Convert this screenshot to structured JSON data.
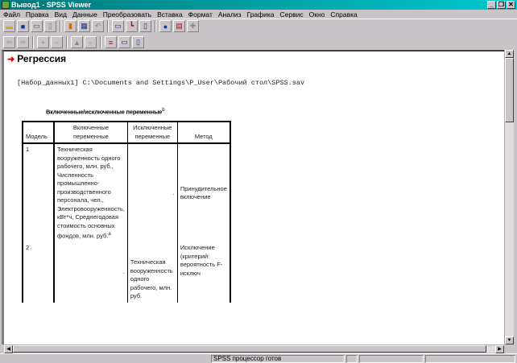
{
  "window": {
    "title": "Вывод1 - SPSS Viewer",
    "controls": [
      "_",
      "❐",
      "✕"
    ]
  },
  "menu": [
    "Файл",
    "Правка",
    "Вид",
    "Данные",
    "Преобразовать",
    "Вставка",
    "Формат",
    "Анализ",
    "Графика",
    "Сервис",
    "Окно",
    "Справка"
  ],
  "toolbar1": [
    "open-icon",
    "save-icon",
    "print-icon",
    "print-preview-icon",
    "export-icon",
    "goto-data-icon",
    "undo-icon",
    "dialog-recall-icon",
    "chart-icon",
    "variables-icon",
    "find-icon",
    "designate-window-icon",
    "insert-icon"
  ],
  "toolbar2": [
    "back-icon",
    "forward-icon",
    "expand-icon",
    "collapse-icon",
    "show-icon",
    "hide-icon",
    "insert-heading-icon",
    "insert-title-icon",
    "insert-text-icon"
  ],
  "output": {
    "heading": "Регрессия",
    "dataset_path": "[Набор_данных1] C:\\Documents and Settings\\P_User\\Рабочий стол\\SPSS.sav",
    "table": {
      "caption": "Включенные/исключенные переменные",
      "caption_footnote": "b",
      "headers": [
        "Модель",
        "Включенные переменные",
        "Исключенные переменные",
        "Метод"
      ],
      "rows": [
        {
          "model": "1",
          "included": "Техническая вооруженность одного рабочего, млн. руб., Численность промышленно-производственного персонала, чел., Электровооруженность, кВт*ч, Среднегодовая стоимость основных фондов, млн. руб.",
          "included_footnote": "a",
          "excluded": ".",
          "method": "Принудительное включение"
        },
        {
          "model": "2",
          "included": ".",
          "excluded": "Техническая вооруженность одного рабочего, млн. руб.",
          "method": "Исключение (критерий: вероятность F-исключ"
        }
      ]
    }
  },
  "status": {
    "text": "SPSS процессор готов"
  }
}
